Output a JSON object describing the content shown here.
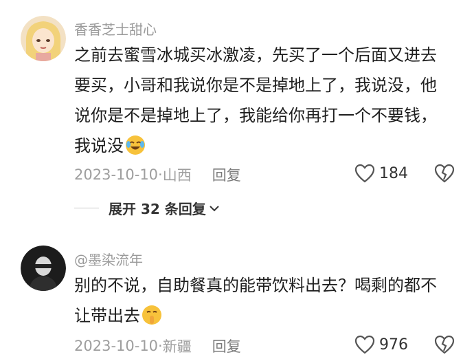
{
  "comments": [
    {
      "username": "香香芝士甜心",
      "text": "之前去蜜雪冰城买冰激凌，先买了一个后面又进去要买，小哥和我说你是不是掉地上了，我说没，他说你是不是掉地上了，我能给你再打一个不要钱，我说没",
      "emoji": "laughing-crying-emoji",
      "date": "2023-10-10",
      "location": "山西",
      "reply_label": "回复",
      "likes": "184",
      "replies_toggle": "展开 32 条回复"
    },
    {
      "username": "@墨染流年",
      "text": "别的不说，自助餐真的能带饮料出去？喝剩的都不让带出去",
      "emoji": "shushing-face-emoji",
      "date": "2023-10-10",
      "location": "新疆",
      "reply_label": "回复",
      "likes": "976"
    }
  ],
  "colors": {
    "meta": "#9e9e9e",
    "text": "#1e1e1e",
    "emoji_yellow": "#f7c23b"
  }
}
